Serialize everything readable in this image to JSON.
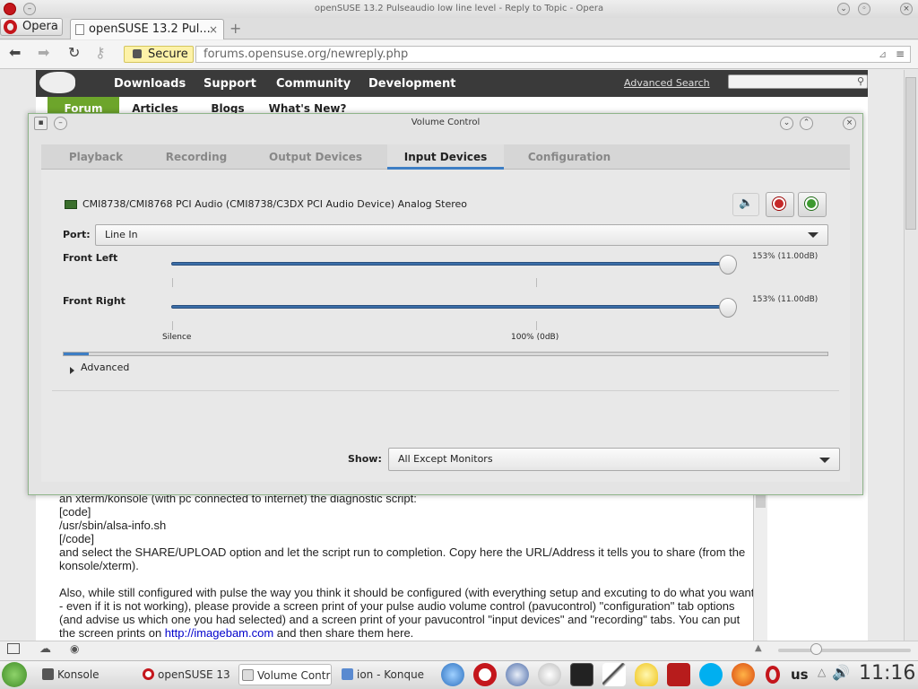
{
  "browser": {
    "window_title": "openSUSE 13.2 Pulseaudio low line level - Reply to Topic - Opera",
    "menu_label": "Opera",
    "tab_title": "openSUSE 13.2 Pul...",
    "tab_close": "×",
    "new_tab": "+",
    "secure_label": "Secure",
    "url": "forums.opensuse.org/newreply.php"
  },
  "site": {
    "nav": [
      "Downloads",
      "Support",
      "Community",
      "Development"
    ],
    "advanced_search": "Advanced Search",
    "subnav": [
      "Forum",
      "Articles",
      "Blogs",
      "What's New?"
    ],
    "post_lines": [
      "an xterm/konsole (with pc connected to internet) the diagnostic script:",
      "[code]",
      "/usr/sbin/alsa-info.sh",
      "[/code]",
      "and select the SHARE/UPLOAD option and let the script run to completion. Copy here the URL/Address it tells you to share (from the konsole/xterm)."
    ],
    "post_para2_a": "Also, while still configured with pulse the way you think it should be configured (with everything setup and excuting to do what you want - even if it is not working), please provide a screen print of your pulse audio volume control (pavucontrol) \"configuration\" tab options (and advise us which one you had selected) and a screen print of your pavucontrol \"input devices\" and \"recording\" tabs. You can put the screen prints on ",
    "post_link": "http://imagebam.com",
    "post_para2_b": " and then share them here."
  },
  "volume_control": {
    "title": "Volume Control",
    "tabs": [
      "Playback",
      "Recording",
      "Output Devices",
      "Input Devices",
      "Configuration"
    ],
    "active_tab": "Input Devices",
    "device_name": "CMI8738/CMI8768 PCI Audio (CMI8738/C3DX PCI Audio Device) Analog Stereo",
    "port_label": "Port:",
    "port_value": "Line In",
    "channels": [
      {
        "name": "Front Left",
        "value": "153% (11.00dB)",
        "level_percent": 153
      },
      {
        "name": "Front Right",
        "value": "153% (11.00dB)",
        "level_percent": 153
      }
    ],
    "scale_silence": "Silence",
    "scale_100": "100% (0dB)",
    "advanced_label": "Advanced",
    "show_label": "Show:",
    "show_value": "All Except Monitors"
  },
  "taskbar": {
    "tasks": [
      "Konsole",
      "openSUSE 13",
      "Volume Contr",
      "ion - Konque"
    ],
    "keyboard_layout": "us",
    "clock": "11:16"
  },
  "colors": {
    "accent": "#3d7ec4",
    "forum_green": "#6da52b",
    "header_dark": "#3a3a3a"
  }
}
